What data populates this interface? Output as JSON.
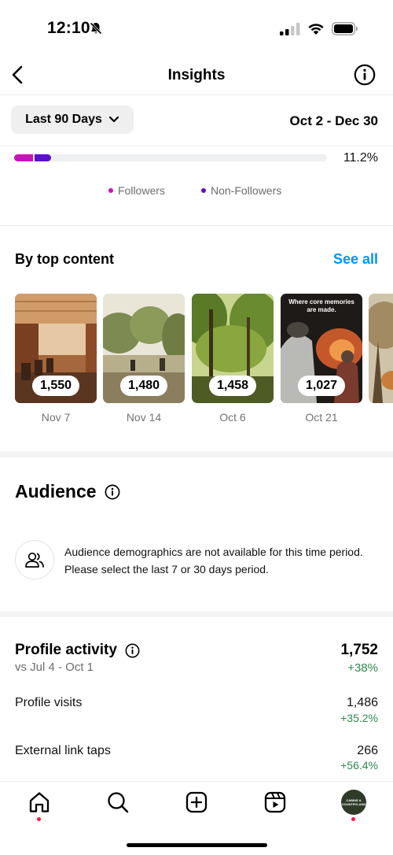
{
  "status": {
    "time": "12:10"
  },
  "nav": {
    "title": "Insights"
  },
  "filter": {
    "range_label": "Last 90 Days",
    "date_range": "Oct 2 - Dec 30"
  },
  "reach_bar": {
    "percent_label": "11.2%",
    "colors": {
      "followers": "#c913b9",
      "non_followers": "#5b0fcf"
    },
    "legend": [
      "Followers",
      "Non-Followers"
    ]
  },
  "top_content": {
    "title": "By top content",
    "see_all": "See all",
    "items": [
      {
        "count": "1,550",
        "date": "Nov 7"
      },
      {
        "count": "1,480",
        "date": "Nov 14"
      },
      {
        "count": "1,458",
        "date": "Oct 6"
      },
      {
        "count": "1,027",
        "date": "Oct 21",
        "caption": "Where core memories are made."
      }
    ]
  },
  "audience": {
    "title": "Audience",
    "message": "Audience demographics are not available for this time period. Please select the last 7 or 30 days period."
  },
  "profile_activity": {
    "title": "Profile activity",
    "compare": "vs Jul 4 - Oct 1",
    "total": "1,752",
    "total_change": "+38%",
    "rows": [
      {
        "label": "Profile visits",
        "value": "1,486",
        "change": "+35.2%"
      },
      {
        "label": "External link taps",
        "value": "266",
        "change": "+56.4%"
      }
    ]
  },
  "tabbar": {
    "items": [
      "home-icon",
      "search-icon",
      "create-icon",
      "reels-icon",
      "profile-avatar"
    ],
    "avatar_text": "CABINS & COUNTRYLAND"
  }
}
